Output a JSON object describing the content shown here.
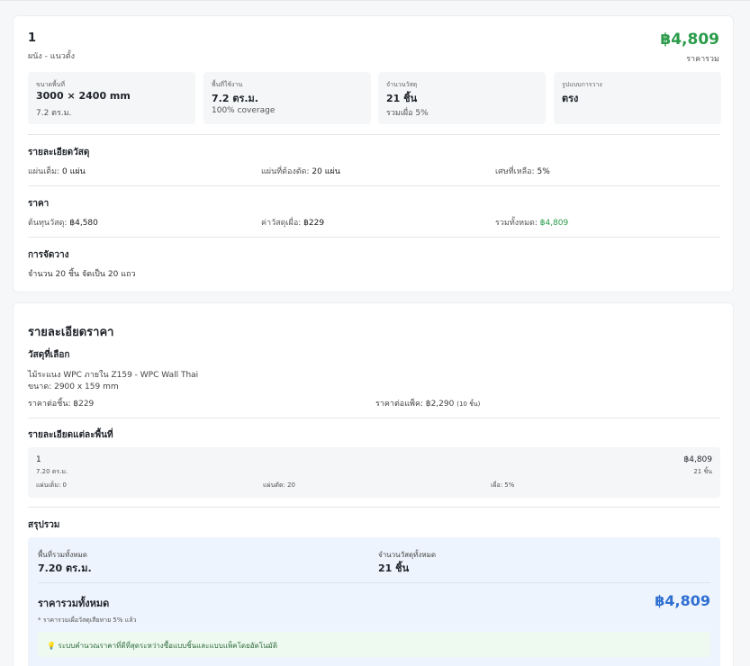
{
  "area": {
    "title": "1",
    "subtitle": "ผนัง - แนวตั้ง",
    "total_price": "฿4,809",
    "total_label": "ราคารวม",
    "stats": [
      {
        "label": "ขนาดพื้นที่",
        "value": "3000 × 2400 mm",
        "sub": "7.2 ตร.ม."
      },
      {
        "label": "พื้นที่ใช้งาน",
        "value": "7.2 ตร.ม.",
        "sub": "100% coverage"
      },
      {
        "label": "จำนวนวัสดุ",
        "value": "21 ชิ้น",
        "sub": "รวมเผื่อ 5%"
      },
      {
        "label": "รูปแบบการวาง",
        "value": "ตรง",
        "sub": ""
      }
    ],
    "material_section": {
      "title": "รายละเอียดวัสดุ",
      "full_label": "แผ่นเต็ม:",
      "full_value": "0 แผ่น",
      "cut_label": "แผ่นที่ต้องตัด:",
      "cut_value": "20 แผ่น",
      "waste_label": "เศษที่เหลือ:",
      "waste_value": "5%"
    },
    "price_section": {
      "title": "ราคา",
      "cost_label": "ต้นทุนวัสดุ:",
      "cost_value": "฿4,580",
      "waste_label": "ค่าวัสดุเผื่อ:",
      "waste_value": "฿229",
      "total_label": "รวมทั้งหมด:",
      "total_value": "฿4,809"
    },
    "layout_section": {
      "title": "การจัดวาง",
      "text": "จำนวน 20 ชิ้น จัดเป็น 20 แถว"
    }
  },
  "price_detail": {
    "title": "รายละเอียดราคา",
    "selected_title": "วัสดุที่เลือก",
    "material_name": "ไม้ระแนง WPC ภายใน Z159 - WPC Wall Thai",
    "material_size": "ขนาด: 2900 x 159 mm",
    "price_per_piece": "ราคาต่อชิ้น: ฿229",
    "price_per_pack": "ราคาต่อแพ็ค: ฿2,290",
    "pack_qty": "(10 ชิ้น)",
    "per_area_title": "รายละเอียดแต่ละพื้นที่",
    "row": {
      "name": "1",
      "area": "7.20 ตร.ม.",
      "price": "฿4,809",
      "qty": "21 ชิ้น",
      "full": "แผ่นเต็ม: 0",
      "cut": "แผ่นตัด: 20",
      "waste": "เผื่อ: 5%"
    },
    "summary_title": "สรุปรวม",
    "summary": {
      "area_label": "พื้นที่รวมทั้งหมด",
      "area_value": "7.20 ตร.ม.",
      "qty_label": "จำนวนวัสดุทั้งหมด",
      "qty_value": "21 ชิ้น",
      "total_label": "ราคารวมทั้งหมด",
      "total_value": "฿4,809",
      "note": "* ราคารวมเผื่อวัสดุเสียหาย 5% แล้ว",
      "tip_icon": "💡",
      "tip": "ระบบคำนวณราคาที่ดีที่สุดระหว่างซื้อแบบชิ้นและแบบแพ็คโดยอัตโนมัติ"
    }
  },
  "colors": {
    "green": "#2a9b4a",
    "blue": "#2f6fd1"
  }
}
